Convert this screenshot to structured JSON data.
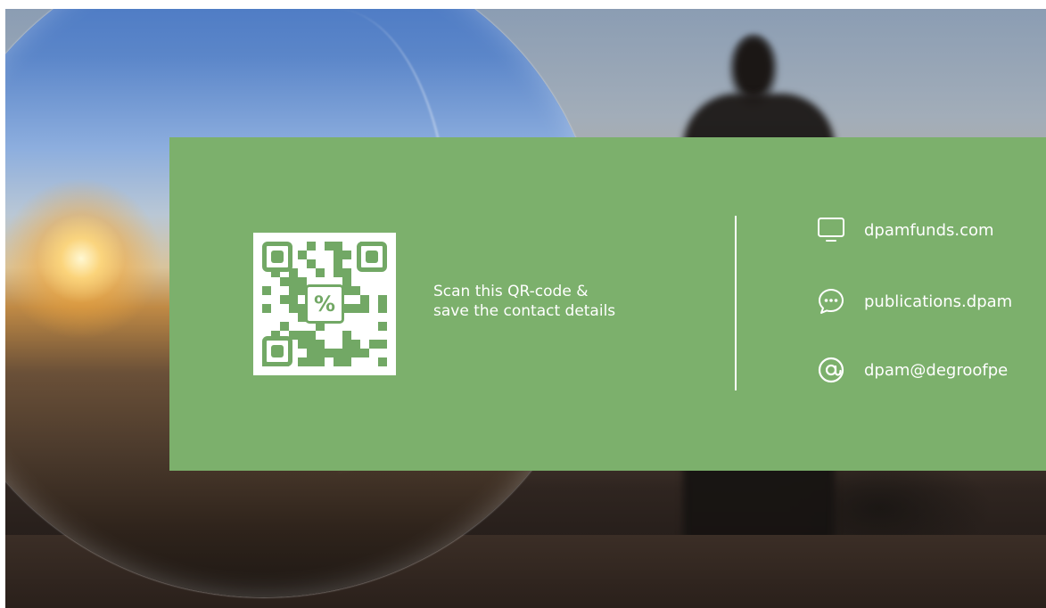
{
  "background": {
    "description_icons": [
      "crystal-ball-image",
      "person-silhouette-image"
    ]
  },
  "panel": {
    "color": "#7cb06c",
    "qr": {
      "center_symbol": "%",
      "icon": "qr-code-icon"
    },
    "scan_text": {
      "line1": "Scan this QR-code &",
      "line2": "save the contact details"
    },
    "contacts": [
      {
        "icon": "monitor-icon",
        "label": "dpamfunds.com"
      },
      {
        "icon": "chat-bubble-icon",
        "label": "publications.dpam"
      },
      {
        "icon": "at-sign-icon",
        "label": "dpam@degroofpe"
      }
    ]
  }
}
